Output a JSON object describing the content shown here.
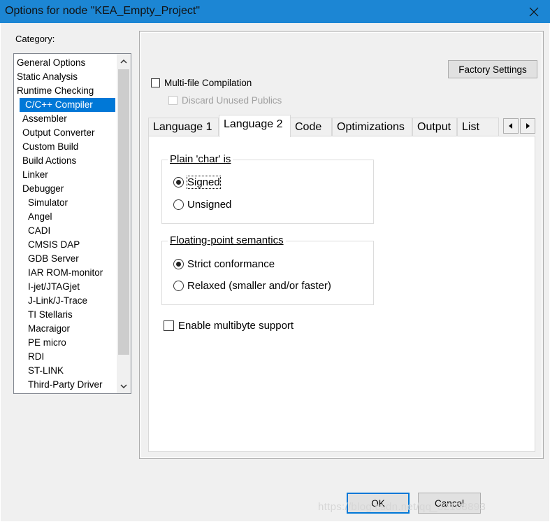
{
  "window": {
    "title": "Options for node \"KEA_Empty_Project\""
  },
  "category": {
    "label": "Category:",
    "items": [
      {
        "label": "General Options",
        "indent": 0,
        "selected": false
      },
      {
        "label": "Static Analysis",
        "indent": 0,
        "selected": false
      },
      {
        "label": "Runtime Checking",
        "indent": 0,
        "selected": false
      },
      {
        "label": "C/C++ Compiler",
        "indent": 1,
        "selected": true
      },
      {
        "label": "Assembler",
        "indent": 1,
        "selected": false
      },
      {
        "label": "Output Converter",
        "indent": 1,
        "selected": false
      },
      {
        "label": "Custom Build",
        "indent": 1,
        "selected": false
      },
      {
        "label": "Build Actions",
        "indent": 1,
        "selected": false
      },
      {
        "label": "Linker",
        "indent": 1,
        "selected": false
      },
      {
        "label": "Debugger",
        "indent": 1,
        "selected": false
      },
      {
        "label": "Simulator",
        "indent": 2,
        "selected": false
      },
      {
        "label": "Angel",
        "indent": 2,
        "selected": false
      },
      {
        "label": "CADI",
        "indent": 2,
        "selected": false
      },
      {
        "label": "CMSIS DAP",
        "indent": 2,
        "selected": false
      },
      {
        "label": "GDB Server",
        "indent": 2,
        "selected": false
      },
      {
        "label": "IAR ROM-monitor",
        "indent": 2,
        "selected": false
      },
      {
        "label": "I-jet/JTAGjet",
        "indent": 2,
        "selected": false
      },
      {
        "label": "J-Link/J-Trace",
        "indent": 2,
        "selected": false
      },
      {
        "label": "TI Stellaris",
        "indent": 2,
        "selected": false
      },
      {
        "label": "Macraigor",
        "indent": 2,
        "selected": false
      },
      {
        "label": "PE micro",
        "indent": 2,
        "selected": false
      },
      {
        "label": "RDI",
        "indent": 2,
        "selected": false
      },
      {
        "label": "ST-LINK",
        "indent": 2,
        "selected": false
      },
      {
        "label": "Third-Party Driver",
        "indent": 2,
        "selected": false
      }
    ]
  },
  "factory_settings": "Factory Settings",
  "multifile": {
    "label": "Multi-file Compilation",
    "checked": false
  },
  "discard": {
    "label": "Discard Unused Publics",
    "checked": false,
    "disabled": true
  },
  "tabs": [
    {
      "label": "Language 1",
      "active": false
    },
    {
      "label": "Language 2",
      "active": true
    },
    {
      "label": "Code",
      "active": false
    },
    {
      "label": "Optimizations",
      "active": false
    },
    {
      "label": "Output",
      "active": false
    },
    {
      "label": "List",
      "active": false
    }
  ],
  "plain_char": {
    "legend": "Plain 'char' is",
    "options": [
      {
        "label": "Signed",
        "selected": true
      },
      {
        "label": "Unsigned",
        "selected": false
      }
    ]
  },
  "floating": {
    "legend": "Floating-point semantics",
    "options": [
      {
        "label": "Strict conformance",
        "selected": true
      },
      {
        "label": "Relaxed (smaller and/or faster)",
        "selected": false
      }
    ]
  },
  "multibyte": {
    "label": "Enable multibyte support",
    "checked": false
  },
  "buttons": {
    "ok": "OK",
    "cancel": "Cancel"
  },
  "watermark": "https://blog.csdn.net/qq_32108893",
  "colors": {
    "titlebar": "#1c86d4",
    "selection": "#0078d7",
    "dialog_bg": "#f0f0f0"
  }
}
